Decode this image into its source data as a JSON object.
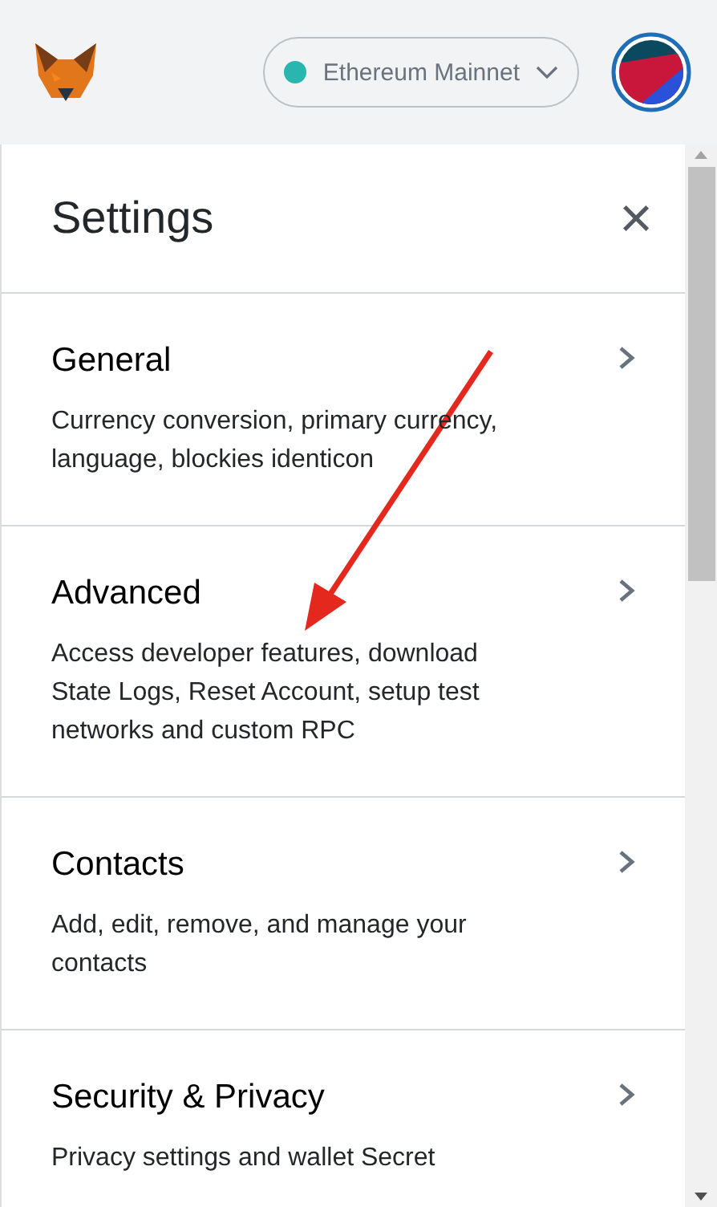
{
  "header": {
    "network": {
      "label": "Ethereum Mainnet",
      "color": "#29b6af"
    }
  },
  "settings": {
    "title": "Settings",
    "close": "×",
    "items": [
      {
        "title": "General",
        "description": "Currency conversion, primary currency, language, blockies identicon"
      },
      {
        "title": "Advanced",
        "description": "Access developer features, download State Logs, Reset Account, setup test networks and custom RPC"
      },
      {
        "title": "Contacts",
        "description": "Add, edit, remove, and manage your contacts"
      },
      {
        "title": "Security & Privacy",
        "description": "Privacy settings and wallet Secret"
      }
    ]
  }
}
